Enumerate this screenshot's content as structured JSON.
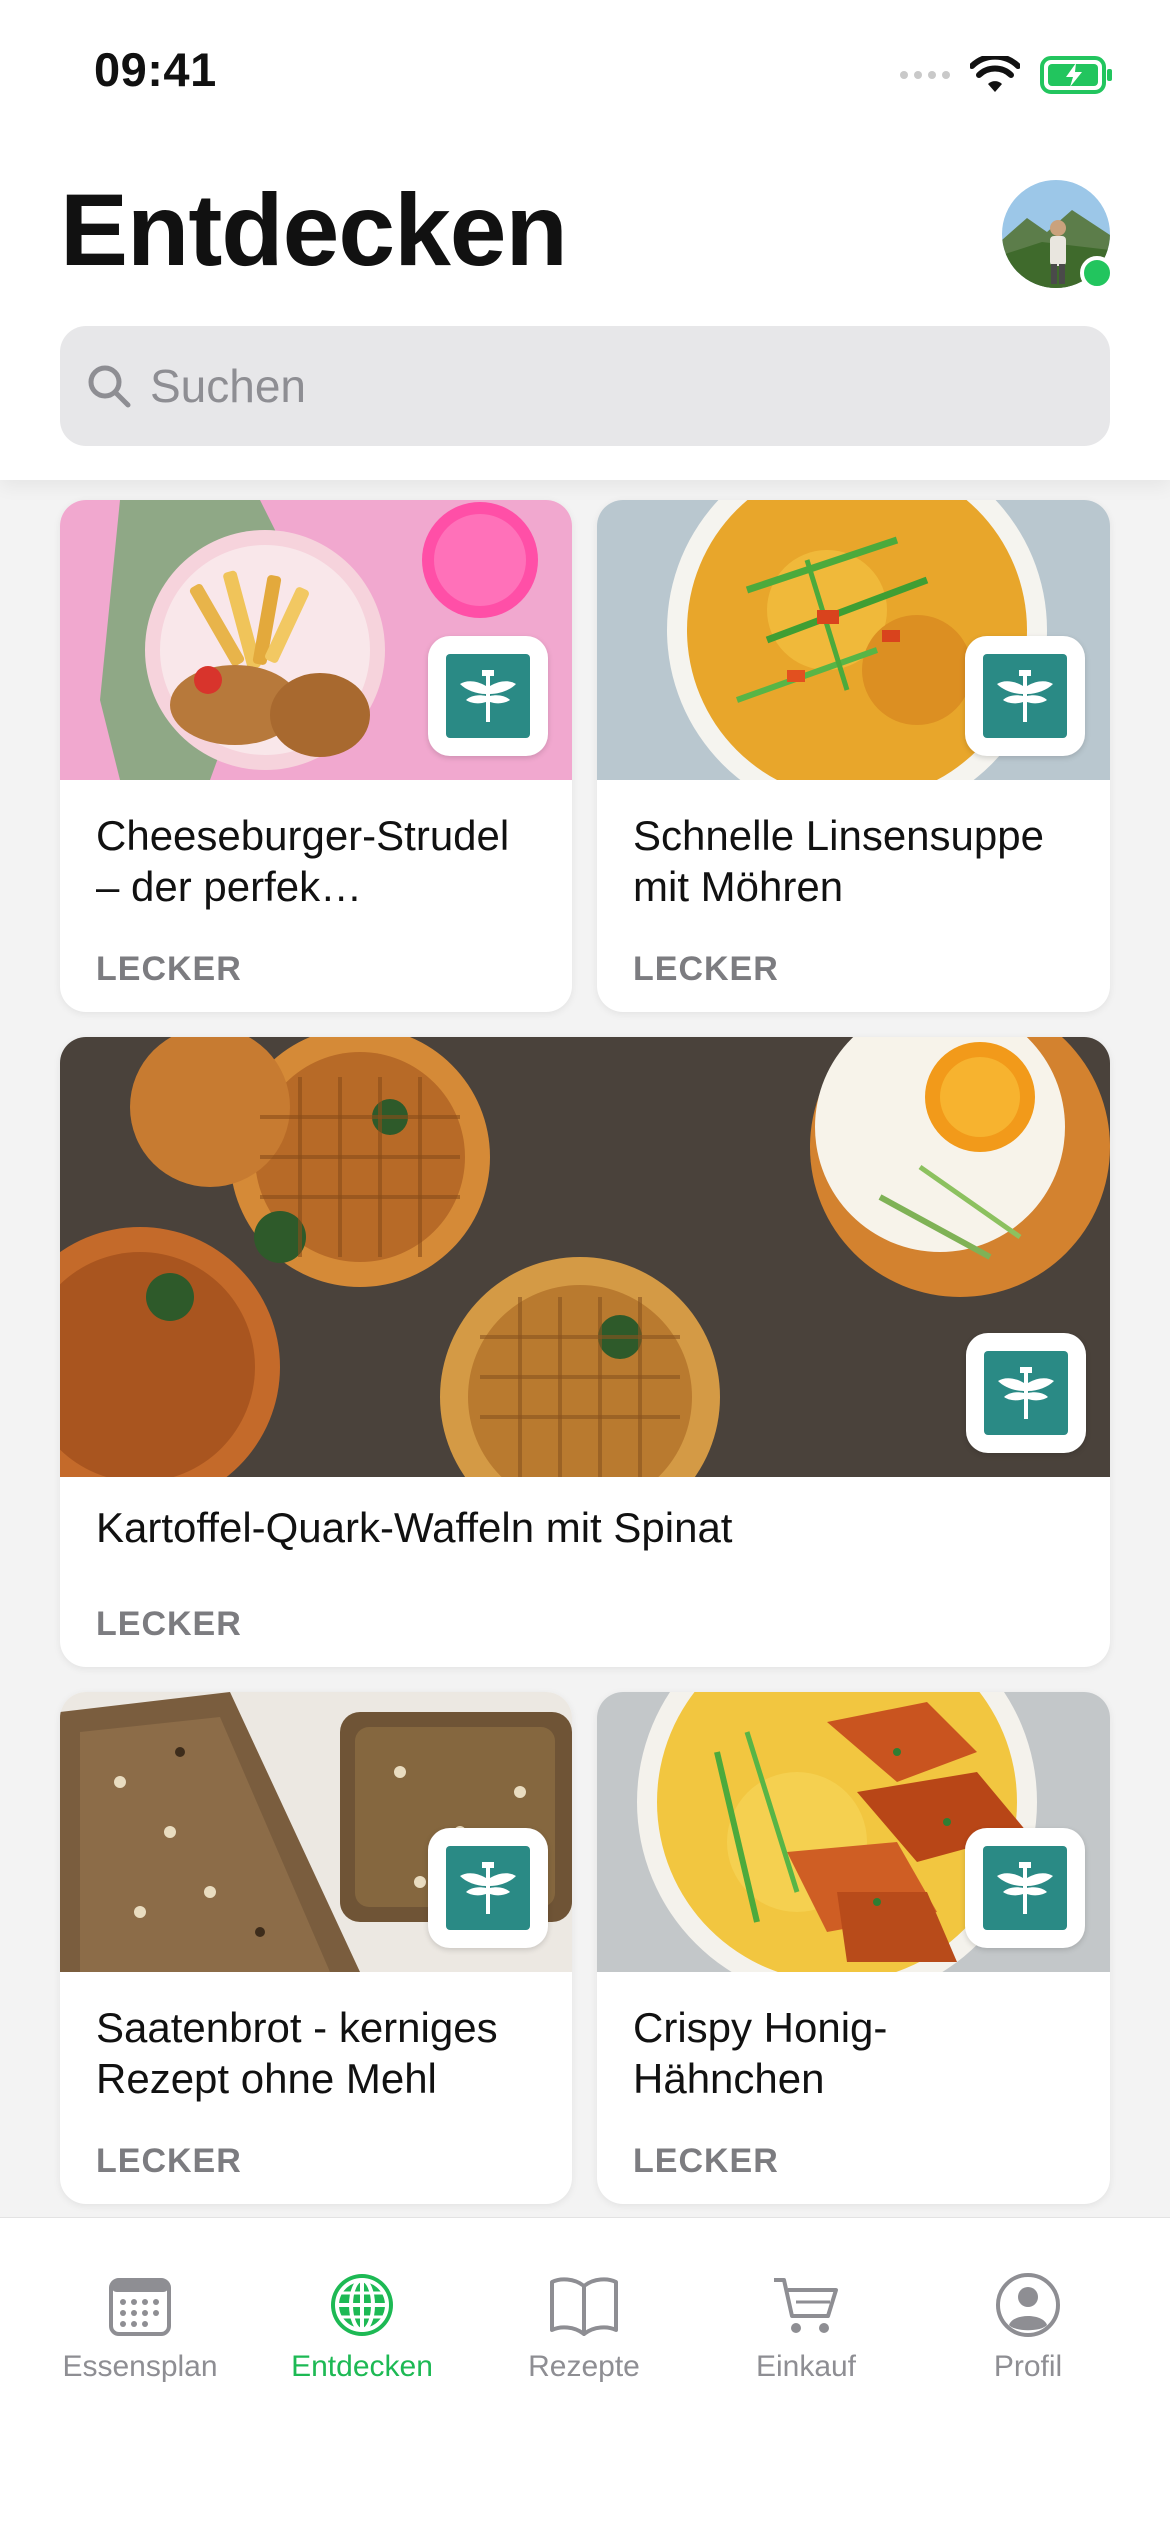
{
  "status_bar": {
    "time": "09:41"
  },
  "header": {
    "title": "Entdecken"
  },
  "search": {
    "placeholder": "Suchen"
  },
  "cards": [
    {
      "title": "Cheeseburger-Strudel – der perfek…",
      "source": "LECKER"
    },
    {
      "title": "Schnelle Linsensuppe mit Möhren",
      "source": "LECKER"
    },
    {
      "title": "Kartoffel-Quark-Waffeln mit Spinat",
      "source": "LECKER"
    },
    {
      "title": "Saatenbrot - kerniges Rezept ohne Mehl",
      "source": "LECKER"
    },
    {
      "title": "Crispy Honig-Hähnchen",
      "source": "LECKER"
    }
  ],
  "tabbar": {
    "items": [
      {
        "label": "Essensplan",
        "icon": "calendar-icon"
      },
      {
        "label": "Entdecken",
        "icon": "globe-icon",
        "active": true
      },
      {
        "label": "Rezepte",
        "icon": "book-icon"
      },
      {
        "label": "Einkauf",
        "icon": "cart-icon"
      },
      {
        "label": "Profil",
        "icon": "person-icon"
      }
    ]
  },
  "colors": {
    "accent": "#1db954",
    "logo": "#2a8a85",
    "online": "#22c55e"
  }
}
